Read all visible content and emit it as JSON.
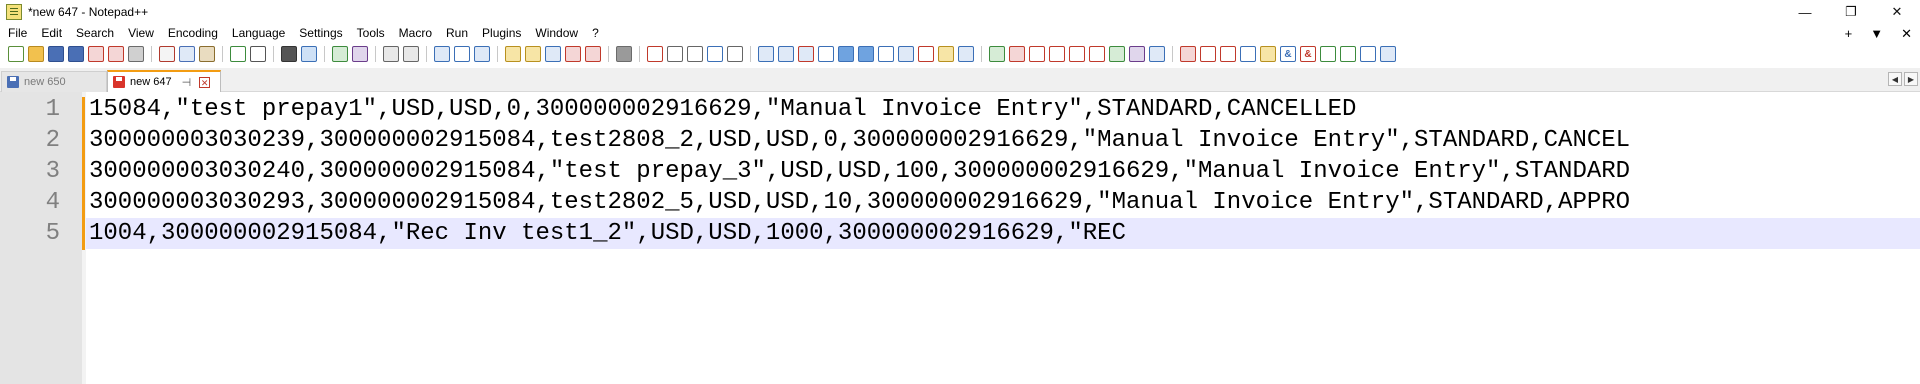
{
  "window": {
    "title": "*new 647 - Notepad++",
    "controls": {
      "minimize": "—",
      "restore": "❐",
      "close": "✕"
    }
  },
  "menu": {
    "items": [
      "File",
      "Edit",
      "Search",
      "View",
      "Encoding",
      "Language",
      "Settings",
      "Tools",
      "Macro",
      "Run",
      "Plugins",
      "Window",
      "?"
    ],
    "right": [
      "+",
      "▼",
      "✕"
    ]
  },
  "toolbar": {
    "icons": [
      {
        "name": "new-file-icon",
        "color": "#ffffff",
        "border": "#5a8f3a"
      },
      {
        "name": "open-file-icon",
        "color": "#f2c14e",
        "border": "#b88a1f"
      },
      {
        "name": "save-icon",
        "color": "#4a6fb5",
        "border": "#2f4f8f"
      },
      {
        "name": "save-all-icon",
        "color": "#4a6fb5",
        "border": "#2f4f8f"
      },
      {
        "name": "close-icon",
        "color": "#f4d6d6",
        "border": "#c0392b"
      },
      {
        "name": "close-all-icon",
        "color": "#f4d6d6",
        "border": "#c0392b"
      },
      {
        "name": "print-icon",
        "color": "#d0d0d0",
        "border": "#6b6b6b"
      },
      {
        "sep": true
      },
      {
        "name": "cut-icon",
        "color": "#f4f4f4",
        "border": "#b03a2e"
      },
      {
        "name": "copy-icon",
        "color": "#dfe9f7",
        "border": "#4a6fb5"
      },
      {
        "name": "paste-icon",
        "color": "#e9dcc0",
        "border": "#8a6d2e"
      },
      {
        "sep": true
      },
      {
        "name": "undo-icon",
        "color": "#ffffff",
        "border": "#3d8b3d"
      },
      {
        "name": "redo-icon",
        "color": "#ffffff",
        "border": "#555555"
      },
      {
        "sep": true
      },
      {
        "name": "find-icon",
        "color": "#555555",
        "border": "#333333"
      },
      {
        "name": "replace-icon",
        "color": "#cfe1f6",
        "border": "#3b6fb6"
      },
      {
        "sep": true
      },
      {
        "name": "zoom-in-icon",
        "color": "#d6ecd6",
        "border": "#3d8b3d"
      },
      {
        "name": "zoom-out-icon",
        "color": "#e0d6ec",
        "border": "#6b3d8b"
      },
      {
        "sep": true
      },
      {
        "name": "sync-vertical-icon",
        "color": "#e8e8e8",
        "border": "#666666"
      },
      {
        "name": "sync-horizontal-icon",
        "color": "#e8e8e8",
        "border": "#666666"
      },
      {
        "sep": true
      },
      {
        "name": "word-wrap-icon",
        "color": "#dfe9f7",
        "border": "#3b6fb6"
      },
      {
        "name": "show-all-chars-icon",
        "color": "#ffffff",
        "border": "#3b6fb6"
      },
      {
        "name": "indent-guide-icon",
        "color": "#dfe9f7",
        "border": "#3b6fb6"
      },
      {
        "sep": true
      },
      {
        "name": "udl-icon",
        "color": "#f7e5a6",
        "border": "#b8901f"
      },
      {
        "name": "doc-map-icon",
        "color": "#f7e5a6",
        "border": "#b8901f"
      },
      {
        "name": "doc-list-icon",
        "color": "#dfe9f7",
        "border": "#3b6fb6"
      },
      {
        "name": "function-list-icon",
        "color": "#f4d6d6",
        "border": "#c0392b"
      },
      {
        "name": "folder-workspace-icon",
        "color": "#f4d6d6",
        "border": "#c0392b"
      },
      {
        "sep": true
      },
      {
        "name": "monitoring-icon",
        "color": "#9a9a9a",
        "border": "#6b6b6b"
      },
      {
        "sep": true
      },
      {
        "name": "record-macro-icon",
        "color": "#ffffff",
        "border": "#c0392b"
      },
      {
        "name": "stop-record-icon",
        "color": "#ffffff",
        "border": "#666666"
      },
      {
        "name": "playback-macro-icon",
        "color": "#ffffff",
        "border": "#666666"
      },
      {
        "name": "run-macro-multiple-icon",
        "color": "#ffffff",
        "border": "#3b6fb6"
      },
      {
        "name": "save-macro-icon",
        "color": "#ffffff",
        "border": "#666666"
      },
      {
        "sep": true
      },
      {
        "name": "bookmark-icon",
        "color": "#dfe9f7",
        "border": "#3b6fb6"
      },
      {
        "name": "compare-icon",
        "color": "#dfe9f7",
        "border": "#3b6fb6"
      },
      {
        "name": "compare-lines-icon",
        "color": "#dfe9f7",
        "border": "#c0392b"
      },
      {
        "name": "align-icon",
        "color": "#ffffff",
        "border": "#3b6fb6"
      },
      {
        "name": "arrow-up-icon",
        "color": "#6fa3e0",
        "border": "#3b6fb6"
      },
      {
        "name": "arrow-down-icon",
        "color": "#6fa3e0",
        "border": "#3b6fb6"
      },
      {
        "name": "align-center-icon",
        "color": "#ffffff",
        "border": "#3b6fb6"
      },
      {
        "name": "grid-icon",
        "color": "#dfe9f7",
        "border": "#3b6fb6"
      },
      {
        "name": "scissors-icon",
        "color": "#ffffff",
        "border": "#c0392b"
      },
      {
        "name": "wand-icon",
        "color": "#f7e5a6",
        "border": "#b8901f"
      },
      {
        "name": "brackets-icon",
        "color": "#dfe9f7",
        "border": "#3b6fb6"
      },
      {
        "sep": true
      },
      {
        "name": "check-icon",
        "color": "#d6ecd6",
        "border": "#3d8b3d"
      },
      {
        "name": "clear-icon",
        "color": "#f4d6d6",
        "border": "#c0392b"
      },
      {
        "name": "first-diff-icon",
        "color": "#ffffff",
        "border": "#c0392b"
      },
      {
        "name": "prev-diff-icon",
        "color": "#ffffff",
        "border": "#c0392b"
      },
      {
        "name": "next-diff-icon",
        "color": "#ffffff",
        "border": "#c0392b"
      },
      {
        "name": "last-diff-icon",
        "color": "#ffffff",
        "border": "#c0392b"
      },
      {
        "name": "diff-green-icon",
        "color": "#d6ecd6",
        "border": "#3d8b3d"
      },
      {
        "name": "diff-purple-icon",
        "color": "#e0d6ec",
        "border": "#6b3d8b"
      },
      {
        "name": "diff-blue-icon",
        "color": "#dfe9f7",
        "border": "#3b6fb6"
      },
      {
        "sep": true
      },
      {
        "name": "tools-icon",
        "color": "#f4d6d6",
        "border": "#c0392b"
      },
      {
        "name": "page-icon",
        "color": "#ffffff",
        "border": "#c0392b"
      },
      {
        "name": "page-alt-icon",
        "color": "#ffffff",
        "border": "#c0392b"
      },
      {
        "name": "preview-icon",
        "color": "#ffffff",
        "border": "#3b6fb6"
      },
      {
        "name": "edit-icon",
        "color": "#f7e5a6",
        "border": "#b8901f"
      },
      {
        "name": "ampersand-icon",
        "color": "#ffffff",
        "border": "#3b6fb6",
        "glyph": "&"
      },
      {
        "name": "ampersand-alt-icon",
        "color": "#ffffff",
        "border": "#c0392b",
        "glyph": "&"
      },
      {
        "name": "arrow-left-icon",
        "color": "#ffffff",
        "border": "#3d8b3d"
      },
      {
        "name": "check-multi-icon",
        "color": "#ffffff",
        "border": "#3d8b3d"
      },
      {
        "name": "arrow-right-icon",
        "color": "#ffffff",
        "border": "#3b6fb6"
      },
      {
        "name": "wrench-icon",
        "color": "#dfe9f7",
        "border": "#3b6fb6"
      }
    ]
  },
  "tabs": [
    {
      "label": "new 650",
      "active": false,
      "unsaved": false
    },
    {
      "label": "new 647",
      "active": true,
      "unsaved": true
    }
  ],
  "tab_arrows": [
    "◀",
    "▶"
  ],
  "tab_icons": {
    "pin": "⊣",
    "close": "✕"
  },
  "editor": {
    "lines": [
      {
        "number": "1",
        "text": "15084,\"test prepay1\",USD,USD,0,300000002916629,\"Manual Invoice Entry\",STANDARD,CANCELLED",
        "current": false
      },
      {
        "number": "2",
        "text": "300000003030239,300000002915084,test2808_2,USD,USD,0,300000002916629,\"Manual Invoice Entry\",STANDARD,CANCEL",
        "current": false
      },
      {
        "number": "3",
        "text": "300000003030240,300000002915084,\"test prepay_3\",USD,USD,100,300000002916629,\"Manual Invoice Entry\",STANDARD",
        "current": false
      },
      {
        "number": "4",
        "text": "300000003030293,300000002915084,test2802_5,USD,USD,10,300000002916629,\"Manual Invoice Entry\",STANDARD,APPRO",
        "current": false
      },
      {
        "number": "5",
        "text": "1004,300000002915084,\"Rec Inv test1_2\",USD,USD,1000,300000002916629,\"REC",
        "current": true
      }
    ]
  }
}
